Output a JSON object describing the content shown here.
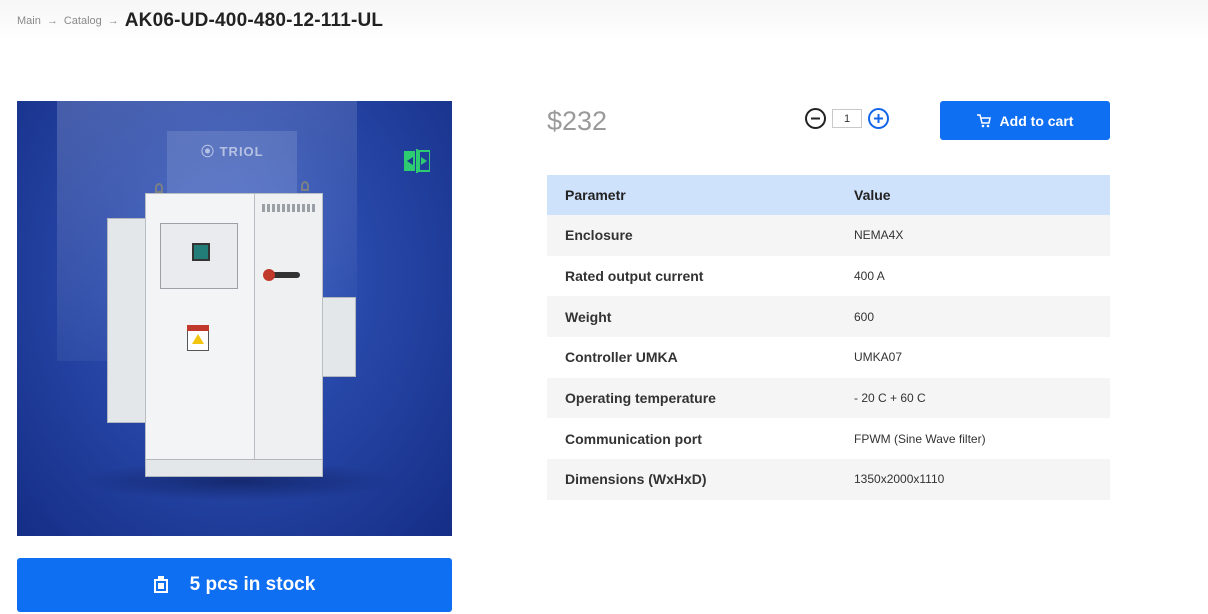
{
  "breadcrumb": {
    "items": [
      "Main",
      "Catalog"
    ],
    "separator": "→",
    "current": "AK06-UD-400-480-12-111-UL"
  },
  "product": {
    "brand_logo": "⦿ TRIOL",
    "price": "$232",
    "stock_label": "5 pcs in stock",
    "image_icons": [
      "compare-icon"
    ]
  },
  "quantity": {
    "value": "1",
    "minus_icon": "minus-circle-icon",
    "plus_icon": "plus-circle-icon"
  },
  "cart": {
    "label": "Add to cart",
    "icon": "cart-icon"
  },
  "params_table": {
    "headers": [
      "Parametr",
      "Value"
    ],
    "rows": [
      {
        "name": "Enclosure",
        "value": "NEMA4X"
      },
      {
        "name": "Rated output current",
        "value": "400 A"
      },
      {
        "name": "Weight",
        "value": "600"
      },
      {
        "name": "Controller UMKA",
        "value": "UMKA07"
      },
      {
        "name": "Operating temperature",
        "value": "- 20 C + 60 C"
      },
      {
        "name": "Communication port",
        "value": "FPWM (Sine Wave filter)"
      },
      {
        "name": "Dimensions (WxHxD)",
        "value": "1350x2000x1110"
      }
    ]
  },
  "colors": {
    "accent": "#0f6ff2",
    "table_header": "#cfe2fb",
    "price": "#9a9a9a"
  }
}
